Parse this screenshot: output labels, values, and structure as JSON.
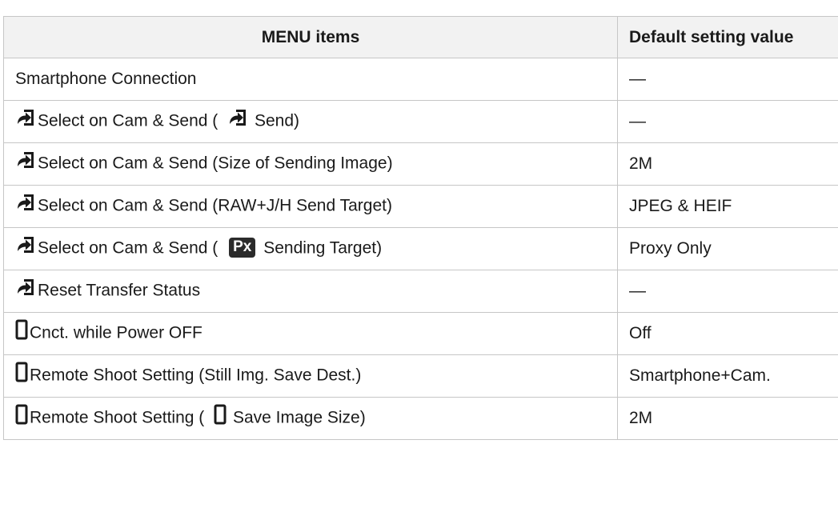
{
  "table": {
    "headers": {
      "menu_items": "MENU items",
      "default_value": "Default setting value"
    },
    "rows": [
      {
        "prefix_icon": "",
        "pre": "Smartphone Connection",
        "inline_icon": "",
        "post": "",
        "value": "—"
      },
      {
        "prefix_icon": "send-to-smartphone-icon",
        "pre": "Select on Cam & Send (",
        "inline_icon": "send-to-smartphone-icon",
        "post": "Send)",
        "value": "—"
      },
      {
        "prefix_icon": "send-to-smartphone-icon",
        "pre": "Select on Cam & Send (Size of Sending Image)",
        "inline_icon": "",
        "post": "",
        "value": "2M"
      },
      {
        "prefix_icon": "send-to-smartphone-icon",
        "pre": "Select on Cam & Send (RAW+J/H Send Target)",
        "inline_icon": "",
        "post": "",
        "value": "JPEG & HEIF"
      },
      {
        "prefix_icon": "send-to-smartphone-icon",
        "pre": "Select on Cam & Send (",
        "inline_icon": "px-proxy-badge",
        "inline_text": "Px",
        "post": "Sending Target)",
        "value": "Proxy Only"
      },
      {
        "prefix_icon": "send-to-smartphone-icon",
        "pre": "Reset Transfer Status",
        "inline_icon": "",
        "post": "",
        "value": "—"
      },
      {
        "prefix_icon": "smartphone-icon",
        "pre": "Cnct. while Power OFF",
        "inline_icon": "",
        "post": "",
        "value": "Off"
      },
      {
        "prefix_icon": "smartphone-icon",
        "pre": "Remote Shoot Setting (Still Img. Save Dest.)",
        "inline_icon": "",
        "post": "",
        "value": "Smartphone+Cam."
      },
      {
        "prefix_icon": "smartphone-icon",
        "pre": "Remote Shoot Setting (",
        "inline_icon": "smartphone-icon",
        "post": "Save Image Size)",
        "value": "2M"
      }
    ]
  },
  "colors": {
    "header_bg": "#f2f2f2",
    "border": "#c6c6c6",
    "text": "#1a1a1a",
    "badge_bg": "#2b2b2b"
  }
}
